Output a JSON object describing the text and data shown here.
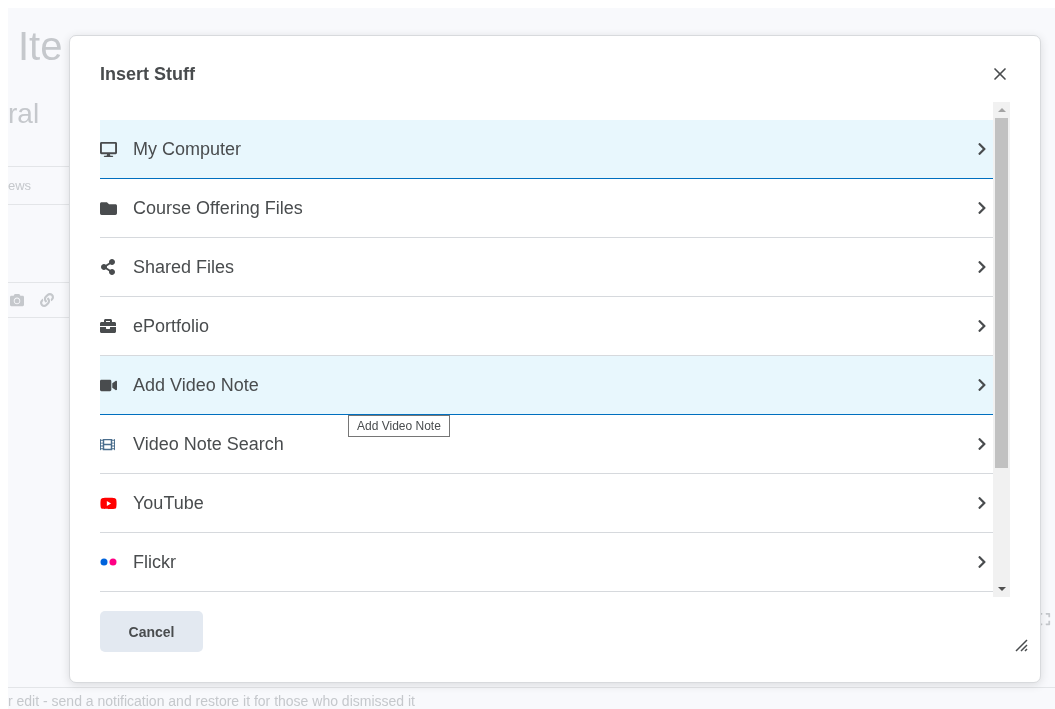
{
  "background_page": {
    "title": "Ite",
    "section_heading": "ral",
    "tab_label": "ews",
    "footer_text": "r edit - send a notification and restore it for those who dismissed it"
  },
  "dialog": {
    "title": "Insert Stuff",
    "items": [
      {
        "kind": "computer",
        "label": "My Computer",
        "highlighted": true
      },
      {
        "kind": "folder",
        "label": "Course Offering Files",
        "highlighted": false
      },
      {
        "kind": "share",
        "label": "Shared Files",
        "highlighted": false
      },
      {
        "kind": "portfolio",
        "label": "ePortfolio",
        "highlighted": false
      },
      {
        "kind": "video",
        "label": "Add Video Note",
        "highlighted": true
      },
      {
        "kind": "film",
        "label": "Video Note Search",
        "highlighted": false
      },
      {
        "kind": "youtube",
        "label": "YouTube",
        "highlighted": false
      },
      {
        "kind": "flickr",
        "label": "Flickr",
        "highlighted": false
      }
    ],
    "tooltip": "Add Video Note",
    "cancel_button": "Cancel"
  }
}
